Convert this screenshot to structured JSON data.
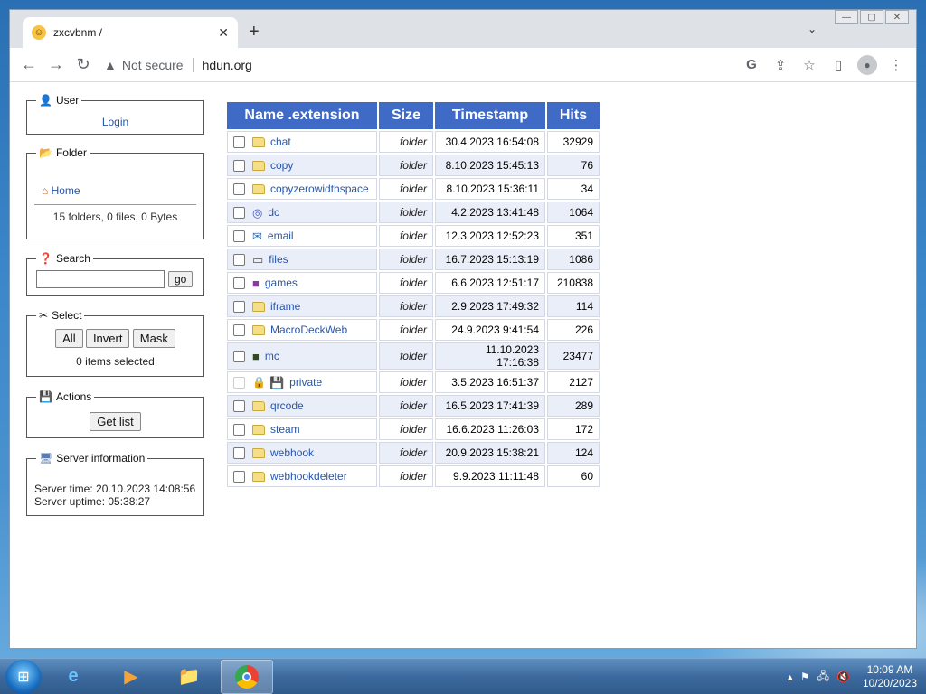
{
  "browser": {
    "tab_title": "zxcvbnm /",
    "tab_close": "✕",
    "new_tab": "+",
    "security_label": "Not secure",
    "url": "hdun.org"
  },
  "sidebar": {
    "user": {
      "legend": "User",
      "login": "Login"
    },
    "folder": {
      "legend": "Folder",
      "home": "Home",
      "summary": "15 folders, 0 files, 0 Bytes"
    },
    "search": {
      "legend": "Search",
      "input_value": "",
      "go": "go"
    },
    "select": {
      "legend": "Select",
      "all": "All",
      "invert": "Invert",
      "mask": "Mask",
      "status": "0 items selected"
    },
    "actions": {
      "legend": "Actions",
      "get_list": "Get list"
    },
    "server": {
      "legend": "Server information",
      "time": "Server time: 20.10.2023 14:08:56",
      "uptime": "Server uptime: 05:38:27"
    }
  },
  "table": {
    "headers": {
      "name": "Name .extension",
      "size": "Size",
      "timestamp": "Timestamp",
      "hits": "Hits"
    },
    "rows": [
      {
        "name": "chat",
        "size": "folder",
        "timestamp": "30.4.2023 16:54:08",
        "hits": "32929",
        "icon": "folder-icon"
      },
      {
        "name": "copy",
        "size": "folder",
        "timestamp": "8.10.2023 15:45:13",
        "hits": "76",
        "icon": "folder-icon"
      },
      {
        "name": "copyzerowidthspace",
        "size": "folder",
        "timestamp": "8.10.2023 15:36:11",
        "hits": "34",
        "icon": "folder-icon"
      },
      {
        "name": "dc",
        "size": "folder",
        "timestamp": "4.2.2023 13:41:48",
        "hits": "1064",
        "icon": "dc-icon"
      },
      {
        "name": "email",
        "size": "folder",
        "timestamp": "12.3.2023 12:52:23",
        "hits": "351",
        "icon": "email-icon"
      },
      {
        "name": "files",
        "size": "folder",
        "timestamp": "16.7.2023 15:13:19",
        "hits": "1086",
        "icon": "files-icon"
      },
      {
        "name": "games",
        "size": "folder",
        "timestamp": "6.6.2023 12:51:17",
        "hits": "210838",
        "icon": "games-icon"
      },
      {
        "name": "iframe",
        "size": "folder",
        "timestamp": "2.9.2023 17:49:32",
        "hits": "114",
        "icon": "folder-icon"
      },
      {
        "name": "MacroDeckWeb",
        "size": "folder",
        "timestamp": "24.9.2023 9:41:54",
        "hits": "226",
        "icon": "folder-icon"
      },
      {
        "name": "mc",
        "size": "folder",
        "timestamp": "11.10.2023 17:16:38",
        "hits": "23477",
        "icon": "mc-icon"
      },
      {
        "name": "private",
        "size": "folder",
        "timestamp": "3.5.2023 16:51:37",
        "hits": "2127",
        "icon": "floppy-icon"
      },
      {
        "name": "qrcode",
        "size": "folder",
        "timestamp": "16.5.2023 17:41:39",
        "hits": "289",
        "icon": "folder-icon"
      },
      {
        "name": "steam",
        "size": "folder",
        "timestamp": "16.6.2023 11:26:03",
        "hits": "172",
        "icon": "folder-icon"
      },
      {
        "name": "webhook",
        "size": "folder",
        "timestamp": "20.9.2023 15:38:21",
        "hits": "124",
        "icon": "folder-icon"
      },
      {
        "name": "webhookdeleter",
        "size": "folder",
        "timestamp": "9.9.2023 11:11:48",
        "hits": "60",
        "icon": "folder-icon"
      }
    ]
  },
  "taskbar": {
    "time": "10:09 AM",
    "date": "10/20/2023"
  }
}
